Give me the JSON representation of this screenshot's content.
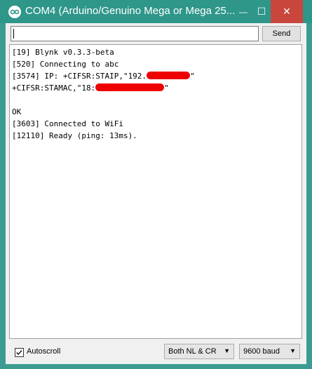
{
  "window": {
    "title": "COM4 (Arduino/Genuino Mega or Mega 25...",
    "icon": "arduino-logo-icon",
    "controls": {
      "minimize": "—",
      "maximize": "☐",
      "close": "✕"
    }
  },
  "toolbar": {
    "input_value": "",
    "send_label": "Send"
  },
  "serial_output": {
    "lines": [
      "[19] Blynk v0.3.3-beta",
      "[520] Connecting to abc",
      "[3574] IP: +CIFSR:STAIP,\"192.",
      "+CIFSR:STAMAC,\"18:",
      "",
      "OK",
      "[3603] Connected to WiFi",
      "[12110] Ready (ping: 13ms)."
    ],
    "redacted_suffix": "\""
  },
  "footer": {
    "autoscroll_label": "Autoscroll",
    "autoscroll_checked": true,
    "line_ending": "Both NL & CR",
    "baud_rate": "9600 baud"
  },
  "colors": {
    "titlebar": "#2f968a",
    "close": "#c9463d",
    "redaction": "#ee0000"
  }
}
